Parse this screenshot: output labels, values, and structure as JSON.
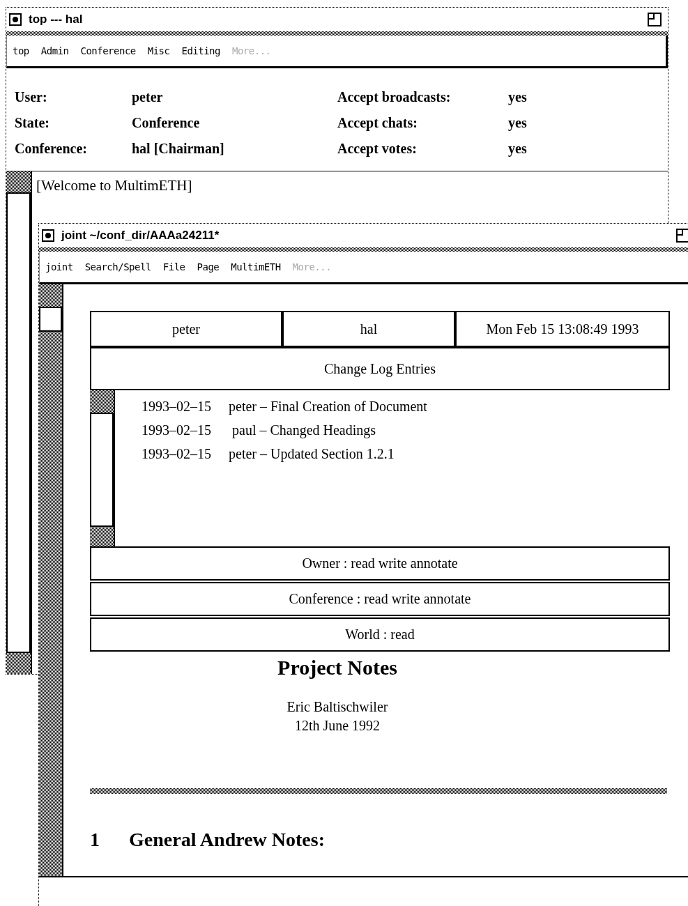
{
  "windows": [
    {
      "title": "top --- hal",
      "menu": [
        {
          "label": "top",
          "disabled": false
        },
        {
          "label": "Admin",
          "disabled": false
        },
        {
          "label": "Conference",
          "disabled": false
        },
        {
          "label": "Misc",
          "disabled": false
        },
        {
          "label": "Editing",
          "disabled": false
        },
        {
          "label": "More...",
          "disabled": true
        }
      ],
      "status_left": [
        {
          "label": "User:",
          "value": "peter"
        },
        {
          "label": "State:",
          "value": "Conference"
        },
        {
          "label": "Conference:",
          "value": "hal [Chairman]"
        }
      ],
      "status_right": [
        {
          "label": "Accept broadcasts:",
          "value": "yes"
        },
        {
          "label": "Accept chats:",
          "value": "yes"
        },
        {
          "label": "Accept votes:",
          "value": "yes"
        }
      ],
      "messages": [
        "[Welcome to MultimETH]"
      ]
    },
    {
      "title": "joint ~/conf_dir/AAAa24211*",
      "menu": [
        {
          "label": "joint",
          "disabled": false
        },
        {
          "label": "Search/Spell",
          "disabled": false
        },
        {
          "label": "File",
          "disabled": false
        },
        {
          "label": "Page",
          "disabled": false
        },
        {
          "label": "MultimETH",
          "disabled": false
        },
        {
          "label": "More...",
          "disabled": true
        }
      ],
      "document": {
        "header": [
          "peter",
          "hal",
          "Mon Feb 15 13:08:49 1993"
        ],
        "log_title": "Change Log Entries",
        "log": [
          {
            "date": "1993–02–15",
            "entry": "peter – Final Creation of Document"
          },
          {
            "date": "1993–02–15",
            "entry": " paul – Changed Headings"
          },
          {
            "date": "1993–02–15",
            "entry": "peter – Updated Section 1.2.1"
          }
        ],
        "permissions": [
          "Owner : read write annotate",
          "Conference : read write annotate",
          "World : read"
        ],
        "title": "Project Notes",
        "author": "Eric Baltischwiler",
        "date": "12th June 1992",
        "sections": [
          {
            "number": "1",
            "title": "General Andrew Notes:"
          }
        ]
      }
    }
  ]
}
